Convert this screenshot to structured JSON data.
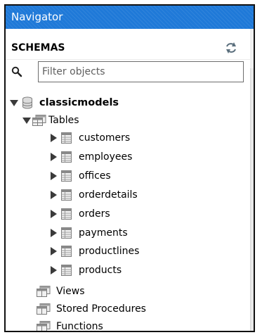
{
  "panel": {
    "title": "Navigator"
  },
  "schemas": {
    "heading": "SCHEMAS",
    "refresh_icon": "refresh-icon"
  },
  "filter": {
    "placeholder": "Filter objects",
    "value": "",
    "icon": "search-icon"
  },
  "tree": {
    "schema": {
      "name": "classicmodels",
      "expanded": true,
      "icon": "database-icon"
    },
    "tables_group": {
      "label": "Tables",
      "expanded": true,
      "icon": "folder-table-icon"
    },
    "tables": [
      {
        "name": "customers"
      },
      {
        "name": "employees"
      },
      {
        "name": "offices"
      },
      {
        "name": "orderdetails"
      },
      {
        "name": "orders"
      },
      {
        "name": "payments"
      },
      {
        "name": "productlines"
      },
      {
        "name": "products"
      }
    ],
    "views": {
      "label": "Views"
    },
    "procedures": {
      "label": "Stored Procedures"
    },
    "functions": {
      "label": "Functions"
    }
  }
}
